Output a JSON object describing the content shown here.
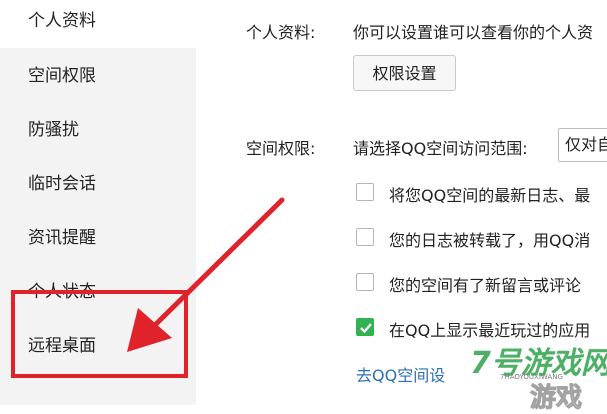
{
  "sidebar": {
    "items": [
      {
        "label": "个人资料"
      },
      {
        "label": "空间权限"
      },
      {
        "label": "防骚扰"
      },
      {
        "label": "临时会话"
      },
      {
        "label": "资讯提醒"
      },
      {
        "label": "个人状态"
      },
      {
        "label": "远程桌面"
      }
    ]
  },
  "profile": {
    "label": "个人资料:",
    "text": "你可以设置谁可以查看你的个人资",
    "button": "权限设置"
  },
  "space": {
    "label": "空间权限:",
    "prompt": "请选择QQ空间访问范围:",
    "selected": "仅对自"
  },
  "checkboxes": [
    {
      "label": "将您QQ空间的最新日志、最",
      "checked": false
    },
    {
      "label": "您的日志被转载了，用QQ消",
      "checked": false
    },
    {
      "label": "您的空间有了新留言或评论",
      "checked": false
    },
    {
      "label": "在QQ上显示最近玩过的应用",
      "checked": true
    }
  ],
  "link": "去QQ空间设",
  "watermark": {
    "main": "7号游戏网",
    "url": "7HAOYOUXIWANG",
    "sub": "游戏"
  },
  "colors": {
    "accent_red": "#e0232a",
    "check_green": "#2fb24f",
    "link_blue": "#2c6fb7"
  }
}
